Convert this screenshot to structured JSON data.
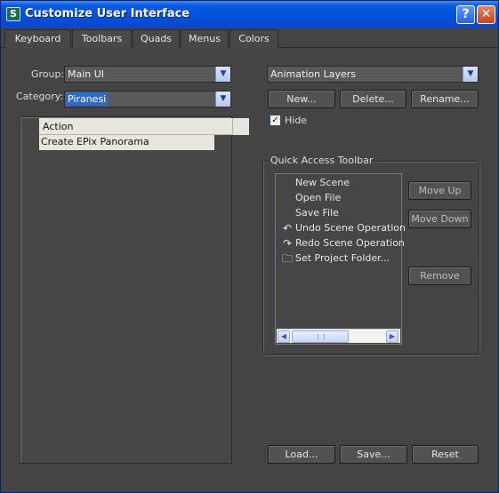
{
  "window": {
    "title": "Customize User Interface",
    "app_icon": "3ds-max-logo-icon",
    "app_icon_glyph": "S",
    "help_glyph": "?",
    "close_glyph": "✕"
  },
  "tabs": [
    {
      "label": "Keyboard"
    },
    {
      "label": "Toolbars",
      "active": true
    },
    {
      "label": "Quads"
    },
    {
      "label": "Menus"
    },
    {
      "label": "Colors"
    }
  ],
  "left": {
    "group_label": "Group:",
    "group_value": "Main UI",
    "category_label": "Category:",
    "category_value": "Piranesi",
    "list_header": "Action",
    "actions": [
      "Create EPix Panorama"
    ]
  },
  "right": {
    "toolbar_value": "Animation Layers",
    "new_label": "New...",
    "delete_label": "Delete...",
    "rename_label": "Rename...",
    "hide_label": "Hide",
    "hide_checked": true,
    "check_glyph": "✓",
    "quick_access_title": "Quick Access Toolbar",
    "quick_access_items": [
      {
        "label": "New Scene",
        "icon": ""
      },
      {
        "label": "Open File",
        "icon": ""
      },
      {
        "label": "Save File",
        "icon": ""
      },
      {
        "label": "Undo Scene Operation",
        "icon": "undo-icon",
        "glyph": "↶"
      },
      {
        "label": "Redo Scene Operation",
        "icon": "redo-icon",
        "glyph": "↷"
      },
      {
        "label": "Set Project Folder...",
        "icon": "project-folder-icon",
        "glyph": "🗀"
      }
    ],
    "move_up_label": "Move Up",
    "move_down_label": "Move Down",
    "remove_label": "Remove"
  },
  "bottom": {
    "load_label": "Load...",
    "save_label": "Save...",
    "reset_label": "Reset"
  },
  "scroll": {
    "left_glyph": "◀",
    "right_glyph": "▶",
    "combo_arrow_glyph": "▼"
  },
  "colors": {
    "window_bg": "#444444",
    "titlebar_blue": "#0152da",
    "selection_blue": "#3169c6"
  }
}
